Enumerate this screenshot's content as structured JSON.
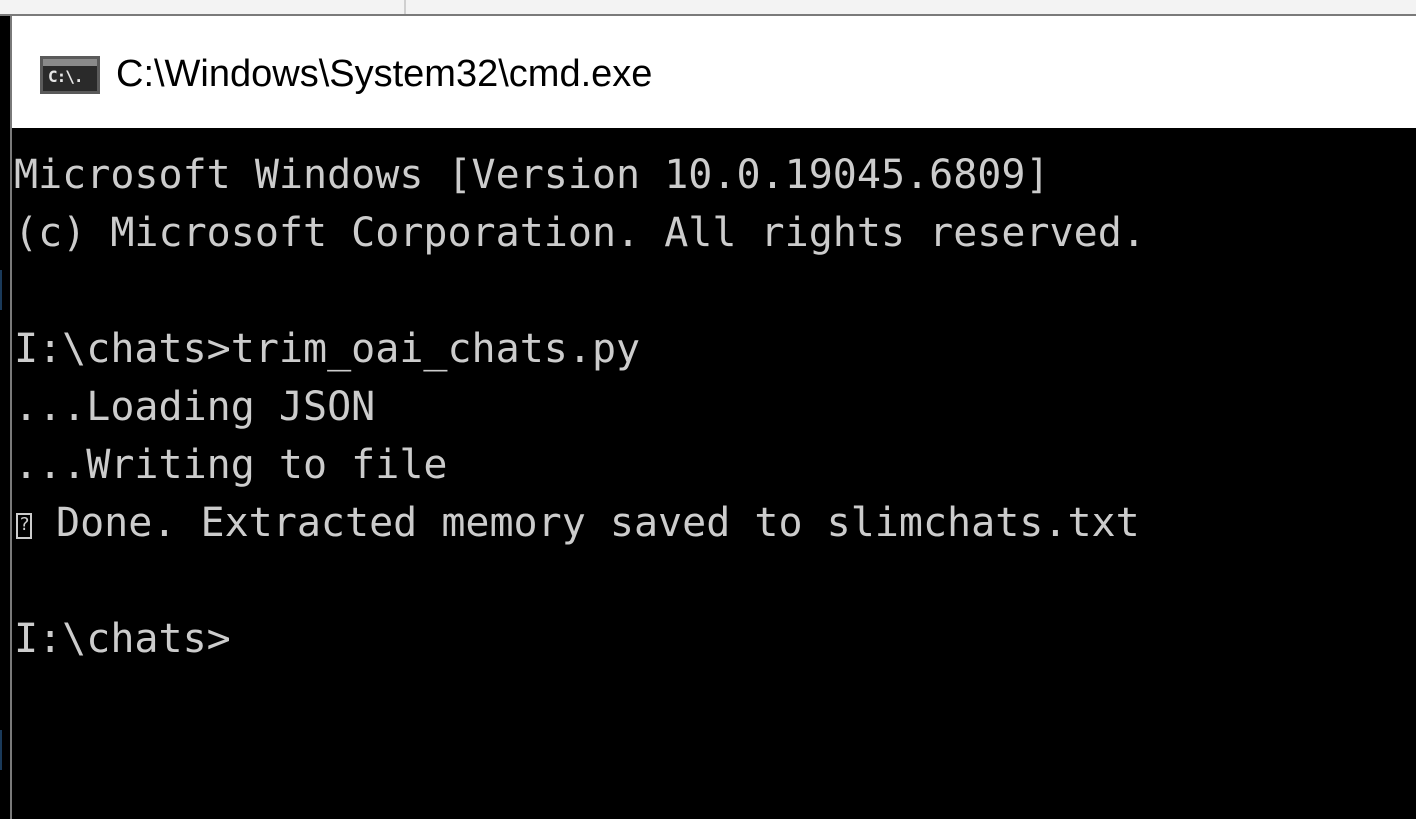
{
  "window": {
    "title": "C:\\Windows\\System32\\cmd.exe",
    "icon": "cmd-icon",
    "icon_glyph": "C:\\."
  },
  "console": {
    "lines": [
      "Microsoft Windows [Version 10.0.19045.6809]",
      "(c) Microsoft Corporation. All rights reserved.",
      "",
      "I:\\chats>trim_oai_chats.py",
      "...Loading JSON",
      "...Writing to file",
      "Done. Extracted memory saved to slimchats.txt",
      "",
      "I:\\chats>"
    ],
    "unrenderable_glyph_icon": "missing-glyph-icon",
    "text_color": "#cccccc",
    "background_color": "#000000"
  }
}
